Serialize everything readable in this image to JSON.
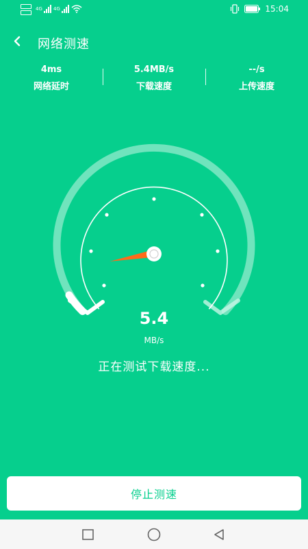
{
  "status_bar": {
    "net_left_1": "4G",
    "net_left_2": "4G",
    "time": "15:04"
  },
  "header": {
    "title": "网络测速"
  },
  "stats": {
    "latency_value": "4ms",
    "latency_label": "网络延时",
    "download_value": "5.4MB/s",
    "download_label": "下载速度",
    "upload_value": "--/s",
    "upload_label": "上传速度"
  },
  "gauge": {
    "speed_value": "5.4",
    "speed_unit": "MB/s",
    "progress_fraction": 0.04
  },
  "status": {
    "message": "正在测试下载速度..."
  },
  "actions": {
    "stop_label": "停止测速"
  },
  "colors": {
    "background": "#06cf8d",
    "needle": "#ff6a1a",
    "button_text": "#06cf8d"
  },
  "icons": {
    "back": "chevron-left-icon",
    "vibrate": "vibrate-icon",
    "battery": "battery-icon",
    "wifi": "wifi-icon",
    "nav_recent": "square-icon",
    "nav_home": "circle-icon",
    "nav_back": "triangle-back-icon"
  }
}
